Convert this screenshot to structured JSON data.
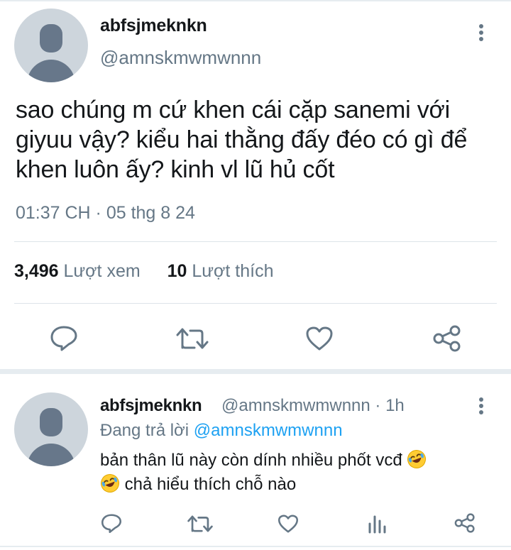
{
  "main_tweet": {
    "display_name": "abfsjmeknkn",
    "handle": "@amnskmwmwnnn",
    "text": "sao chúng m cứ khen cái cặp sanemi với giyuu vậy? kiểu hai thằng đấy đéo có gì để khen luôn ấy? kinh vl lũ hủ cốt",
    "timestamp": "01:37 CH · 05 thg 8 24",
    "stats": {
      "views_count": "3,496",
      "views_label": "Lượt xem",
      "likes_count": "10",
      "likes_label": "Lượt thích"
    },
    "actions": [
      "reply-icon",
      "retweet-icon",
      "like-icon",
      "share-icon"
    ]
  },
  "reply": {
    "display_name": "abfsjmeknkn",
    "meta": "@amnskmwmwnnn · 1h",
    "replying_prefix": "Đang trả lời",
    "replying_to": "@amnskmwmwnnn",
    "text_part1": "bản thân lũ này còn dính nhiều phốt vcđ",
    "text_part2": "chả hiểu thích chỗ nào",
    "actions": [
      "reply-icon",
      "retweet-icon",
      "like-icon",
      "analytics-icon",
      "share-icon"
    ]
  },
  "colors": {
    "text": "#14171a",
    "secondary": "#657786",
    "link": "#1da1f2",
    "divider": "#e6ecf0"
  }
}
